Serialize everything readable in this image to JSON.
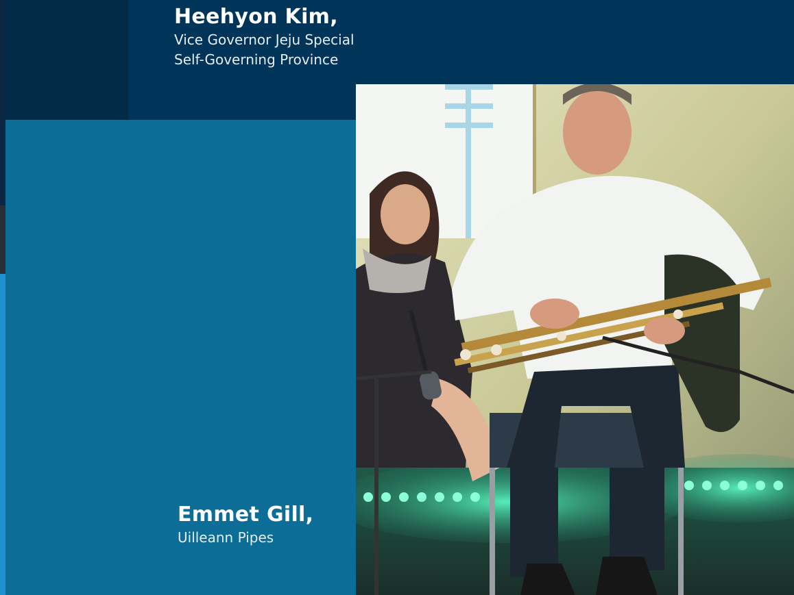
{
  "speakers": [
    {
      "name": "Heehyon Kim,",
      "role_line1": "Vice Governor Jeju Special",
      "role_line2": "Self-Governing Province"
    },
    {
      "name": "Emmet Gill,",
      "role_line1": "Uilleann Pipes"
    }
  ],
  "photo": {
    "subject": "musician-playing-uilleann-pipes"
  },
  "colors": {
    "navy": "#013459",
    "teal": "#0c6e97",
    "dark": "#022b47"
  }
}
